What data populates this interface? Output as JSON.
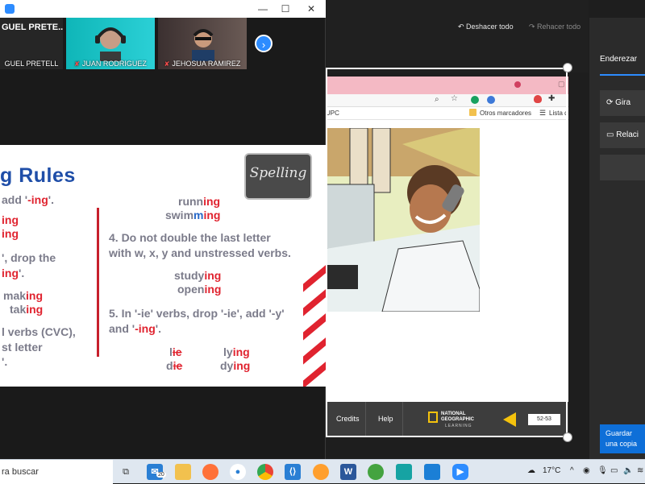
{
  "zoom": {
    "participants": [
      {
        "name": "GUEL PRETELL",
        "display": "GUEL  PRETE..."
      },
      {
        "name": "JUAN RODRIGUEZ"
      },
      {
        "name": "JEHOSUA RAMIREZ"
      }
    ],
    "title_controls": [
      "—",
      "☐",
      "✕"
    ]
  },
  "slide": {
    "title": "g Rules",
    "spelling_card": "Spelling",
    "left": {
      "line1_a": "add '",
      "line1_b": "-ing",
      "line1_c": "'.",
      "ing1": "ing",
      "ing2": "ing",
      "rule2_a": "', drop the",
      "rule2_b": "ing",
      "rule2_c": "'.",
      "mak": "mak",
      "mak_ing": "ing",
      "tak": "tak",
      "tak_ing": "ing",
      "rule3_a": "l verbs (CVC),",
      "rule3_b": "st letter",
      "rule3_c": "'."
    },
    "right": {
      "runn_a": "runn",
      "runn_b": "ing",
      "swimm_a": "swim",
      "swimm_b": "m",
      "swimm_c": "ing",
      "rule4_a": "4. Do not double the last letter",
      "rule4_b": "with w, x, y and unstressed verbs.",
      "study_a": "study",
      "study_b": "ing",
      "open_a": "open",
      "open_b": "ing",
      "rule5_a": "5. In '-ie' verbs, drop '-ie', add '-y'",
      "rule5_b": "and '",
      "rule5_c": "-ing",
      "rule5_d": "'.",
      "lie_a": "l",
      "lie_x": "ie",
      "die_a": "d",
      "die_x": "ie",
      "lying_a": "ly",
      "lying_b": "ing",
      "dying_a": "dy",
      "dying_b": "ing"
    }
  },
  "toolbar": {
    "undo_all": "Deshacer todo",
    "redo_all": "Rehacer todo"
  },
  "browser": {
    "bookmarks_label": "Otros marcadores",
    "reading_list": "Lista de",
    "upc": "UPC"
  },
  "ng": {
    "credits": "Credits",
    "help": "Help",
    "logo": "NATIONAL GEOGRAPHIC",
    "logo_sub": "LEARNING",
    "page": "52-53"
  },
  "panel": {
    "tab": "Enderezar",
    "rotate": "Gira",
    "ratio": "Relaci",
    "save": "Guardar una copia"
  },
  "taskbar": {
    "search_placeholder": "ra buscar",
    "mail_badge": "20",
    "weather": "17°C"
  },
  "colors": {
    "accent": "#2d8cff",
    "slide_red": "#e0232f",
    "slide_blue": "#1f4ea8",
    "save_blue": "#0e6fd8"
  }
}
